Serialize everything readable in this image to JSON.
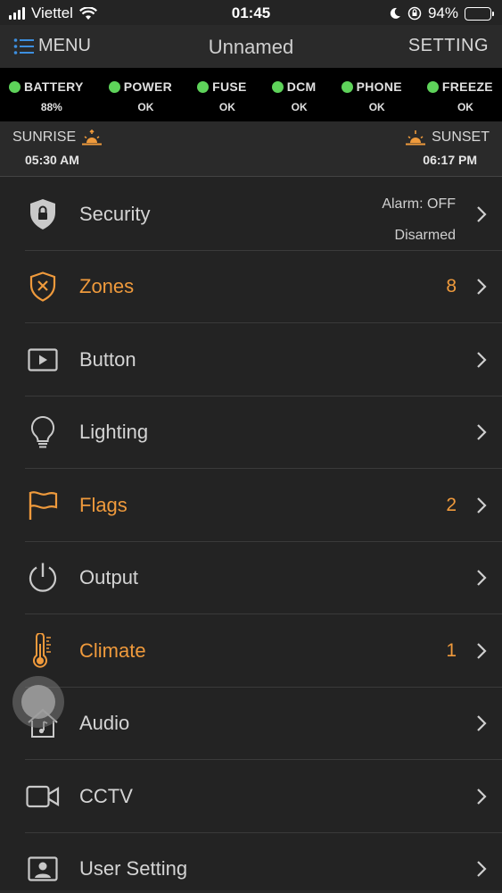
{
  "status_bar": {
    "carrier": "Viettel",
    "time": "01:45",
    "battery": "94%"
  },
  "navbar": {
    "menu_label": "MENU",
    "title": "Unnamed",
    "setting_label": "SETTING"
  },
  "indicators": [
    {
      "label": "BATTERY",
      "value": "88%",
      "color": "#5ed35a"
    },
    {
      "label": "POWER",
      "value": "OK",
      "color": "#5ed35a"
    },
    {
      "label": "FUSE",
      "value": "OK",
      "color": "#5ed35a"
    },
    {
      "label": "DCM",
      "value": "OK",
      "color": "#5ed35a"
    },
    {
      "label": "PHONE",
      "value": "OK",
      "color": "#5ed35a"
    },
    {
      "label": "FREEZE",
      "value": "OK",
      "color": "#5ed35a"
    }
  ],
  "sun": {
    "sunrise_label": "SUNRISE",
    "sunrise_time": "05:30 AM",
    "sunset_label": "SUNSET",
    "sunset_time": "06:17 PM"
  },
  "menu": [
    {
      "label": "Security",
      "icon": "lock-shield-icon",
      "alarm": "Alarm: OFF",
      "state": "Disarmed"
    },
    {
      "label": "Zones",
      "icon": "zone-shield-icon",
      "count": "8"
    },
    {
      "label": "Button",
      "icon": "play-button-icon"
    },
    {
      "label": "Lighting",
      "icon": "light-bulb-icon"
    },
    {
      "label": "Flags",
      "icon": "flag-icon",
      "count": "2"
    },
    {
      "label": "Output",
      "icon": "power-icon"
    },
    {
      "label": "Climate",
      "icon": "thermometer-icon",
      "count": "1"
    },
    {
      "label": "Audio",
      "icon": "music-house-icon"
    },
    {
      "label": "CCTV",
      "icon": "camera-icon"
    },
    {
      "label": "User Setting",
      "icon": "user-card-icon"
    }
  ],
  "colors": {
    "accent": "#ef9a3c",
    "ok": "#5ed35a",
    "menu_blue": "#3d8fe0"
  }
}
